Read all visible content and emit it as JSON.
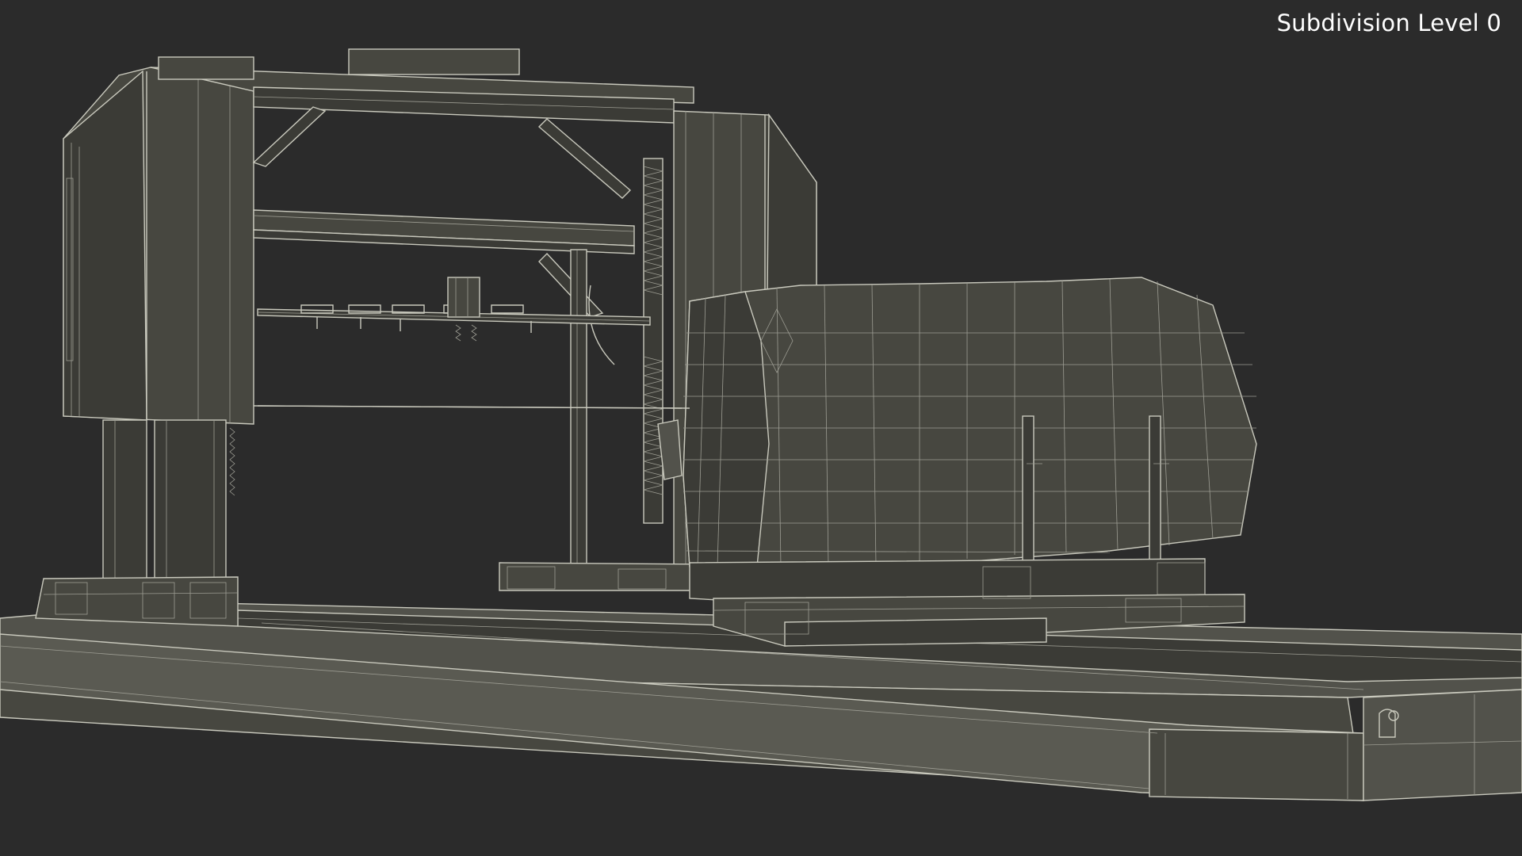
{
  "viewport": {
    "overlay_label": "Subdivision Level 0",
    "background_color": "#2b2b2b",
    "wire_color": "#c9c9bd",
    "surface_color": "#4a4a43"
  }
}
